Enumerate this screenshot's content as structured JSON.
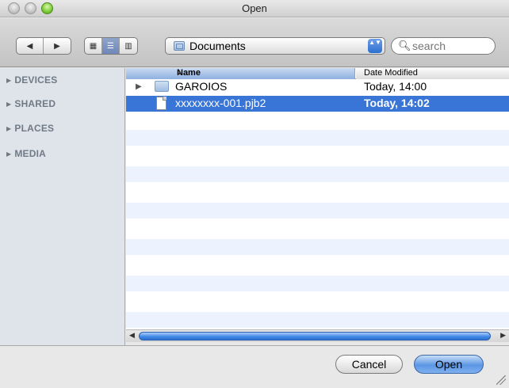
{
  "window": {
    "title": "Open"
  },
  "toolbar": {
    "nav": {
      "back_icon": "back-arrow",
      "forward_icon": "forward-arrow",
      "back_glyph": "◀",
      "forward_glyph": "▶"
    },
    "view_modes": [
      {
        "id": "icon",
        "glyph": "▦",
        "active": false
      },
      {
        "id": "list",
        "glyph": "☰",
        "active": true
      },
      {
        "id": "column",
        "glyph": "▥",
        "active": false
      }
    ],
    "location": "Documents",
    "stepper_glyph": "▲▼",
    "search_placeholder": "search"
  },
  "sidebar": {
    "sections": [
      {
        "label": "DEVICES"
      },
      {
        "label": "SHARED"
      },
      {
        "label": "PLACES"
      },
      {
        "label": "MEDIA"
      }
    ],
    "triangle_glyph": "▶"
  },
  "file_list": {
    "columns": {
      "name": "Name",
      "date": "Date Modified",
      "sort_glyph": "▲"
    },
    "rows": [
      {
        "name": "GAROIOS",
        "date": "Today, 14:00",
        "kind": "folder",
        "selected": false
      },
      {
        "name": "xxxxxxxx-001.pjb2",
        "date": "Today, 14:02",
        "kind": "document",
        "selected": true
      }
    ]
  },
  "buttons": {
    "cancel": "Cancel",
    "open": "Open"
  },
  "colors": {
    "selection": "#3875d7",
    "alt_row": "#edf3fe",
    "sidebar_bg": "#dfe4ea"
  }
}
